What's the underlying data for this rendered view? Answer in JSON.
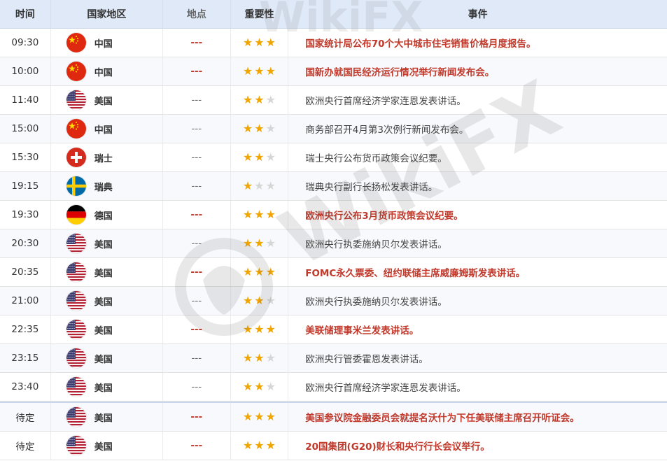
{
  "header": {
    "time": "时间",
    "country": "国家地区",
    "location": "地点",
    "importance": "重要性",
    "event": "事件"
  },
  "watermark": "WikiFX",
  "rows": [
    {
      "time": "09:30",
      "flag": "cn",
      "country": "中国",
      "location": "---",
      "stars": 3,
      "event": "国家统计局公布70个大中城市住宅销售价格月度报告。",
      "highlight": true
    },
    {
      "time": "10:00",
      "flag": "cn",
      "country": "中国",
      "location": "---",
      "stars": 3,
      "event": "国新办就国民经济运行情况举行新闻发布会。",
      "highlight": true
    },
    {
      "time": "11:40",
      "flag": "us",
      "country": "美国",
      "location": "---",
      "stars": 2,
      "event": "欧洲央行首席经济学家连恩发表讲话。",
      "highlight": false
    },
    {
      "time": "15:00",
      "flag": "cn",
      "country": "中国",
      "location": "---",
      "stars": 2,
      "event": "商务部召开4月第3次例行新闻发布会。",
      "highlight": false
    },
    {
      "time": "15:30",
      "flag": "ch",
      "country": "瑞士",
      "location": "---",
      "stars": 2,
      "event": "瑞士央行公布货币政策会议纪要。",
      "highlight": false
    },
    {
      "time": "19:15",
      "flag": "se",
      "country": "瑞典",
      "location": "---",
      "stars": 1,
      "event": "瑞典央行副行长扬松发表讲话。",
      "highlight": false
    },
    {
      "time": "19:30",
      "flag": "de",
      "country": "德国",
      "location": "---",
      "stars": 3,
      "event": "欧洲央行公布3月货币政策会议纪要。",
      "highlight": true
    },
    {
      "time": "20:30",
      "flag": "us",
      "country": "美国",
      "location": "---",
      "stars": 2,
      "event": "欧洲央行执委施纳贝尔发表讲话。",
      "highlight": false
    },
    {
      "time": "20:35",
      "flag": "us",
      "country": "美国",
      "location": "---",
      "stars": 3,
      "event": "FOMC永久票委、纽约联储主席威廉姆斯发表讲话。",
      "highlight": true
    },
    {
      "time": "21:00",
      "flag": "us",
      "country": "美国",
      "location": "---",
      "stars": 2,
      "event": "欧洲央行执委施纳贝尔发表讲话。",
      "highlight": false
    },
    {
      "time": "22:35",
      "flag": "us",
      "country": "美国",
      "location": "---",
      "stars": 3,
      "event": "美联储理事米兰发表讲话。",
      "highlight": true
    },
    {
      "time": "23:15",
      "flag": "us",
      "country": "美国",
      "location": "---",
      "stars": 2,
      "event": "欧洲央行管委霍恩发表讲话。",
      "highlight": false
    },
    {
      "time": "23:40",
      "flag": "us",
      "country": "美国",
      "location": "---",
      "stars": 2,
      "event": "欧洲央行首席经济学家连恩发表讲话。",
      "highlight": false
    },
    {
      "time": "待定",
      "flag": "us",
      "country": "美国",
      "location": "---",
      "stars": 3,
      "event": "美国参议院金融委员会就提名沃什为下任美联储主席召开听证会。",
      "highlight": true
    },
    {
      "time": "待定",
      "flag": "us",
      "country": "美国",
      "location": "---",
      "stars": 3,
      "event": "20国集团(G20)财长和央行行长会议举行。",
      "highlight": true
    }
  ],
  "colors": {
    "highlight": "#c0392b",
    "star_on": "#f0a500",
    "star_off": "#d6d6d6",
    "header_bg": "#dfe9f8"
  }
}
